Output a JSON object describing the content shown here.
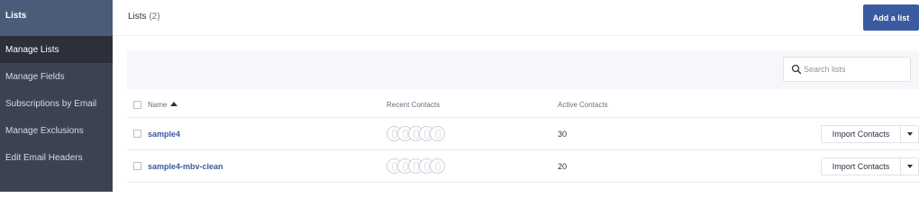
{
  "sidebar": {
    "header": "Lists",
    "items": [
      {
        "label": "Manage Lists"
      },
      {
        "label": "Manage Fields"
      },
      {
        "label": "Subscriptions by Email"
      },
      {
        "label": "Manage Exclusions"
      },
      {
        "label": "Edit Email Headers"
      }
    ]
  },
  "header": {
    "title": "Lists",
    "count": "(2)",
    "add_button": "Add a list"
  },
  "search": {
    "placeholder": "Search lists",
    "value": "",
    "icon": "search-icon"
  },
  "table": {
    "columns": {
      "name": "Name",
      "recent": "Recent Contacts",
      "active": "Active Contacts"
    },
    "sort": "name-ascending",
    "rows": [
      {
        "name": "sample4",
        "active": "30",
        "import_label": "Import Contacts"
      },
      {
        "name": "sample4-mbv-clean",
        "active": "20",
        "import_label": "Import Contacts"
      }
    ]
  },
  "colors": {
    "sidebar": "#3d4251",
    "sidebar_header": "#4a5c79",
    "sidebar_active": "#2b303b",
    "accent": "#3a5ba0"
  }
}
